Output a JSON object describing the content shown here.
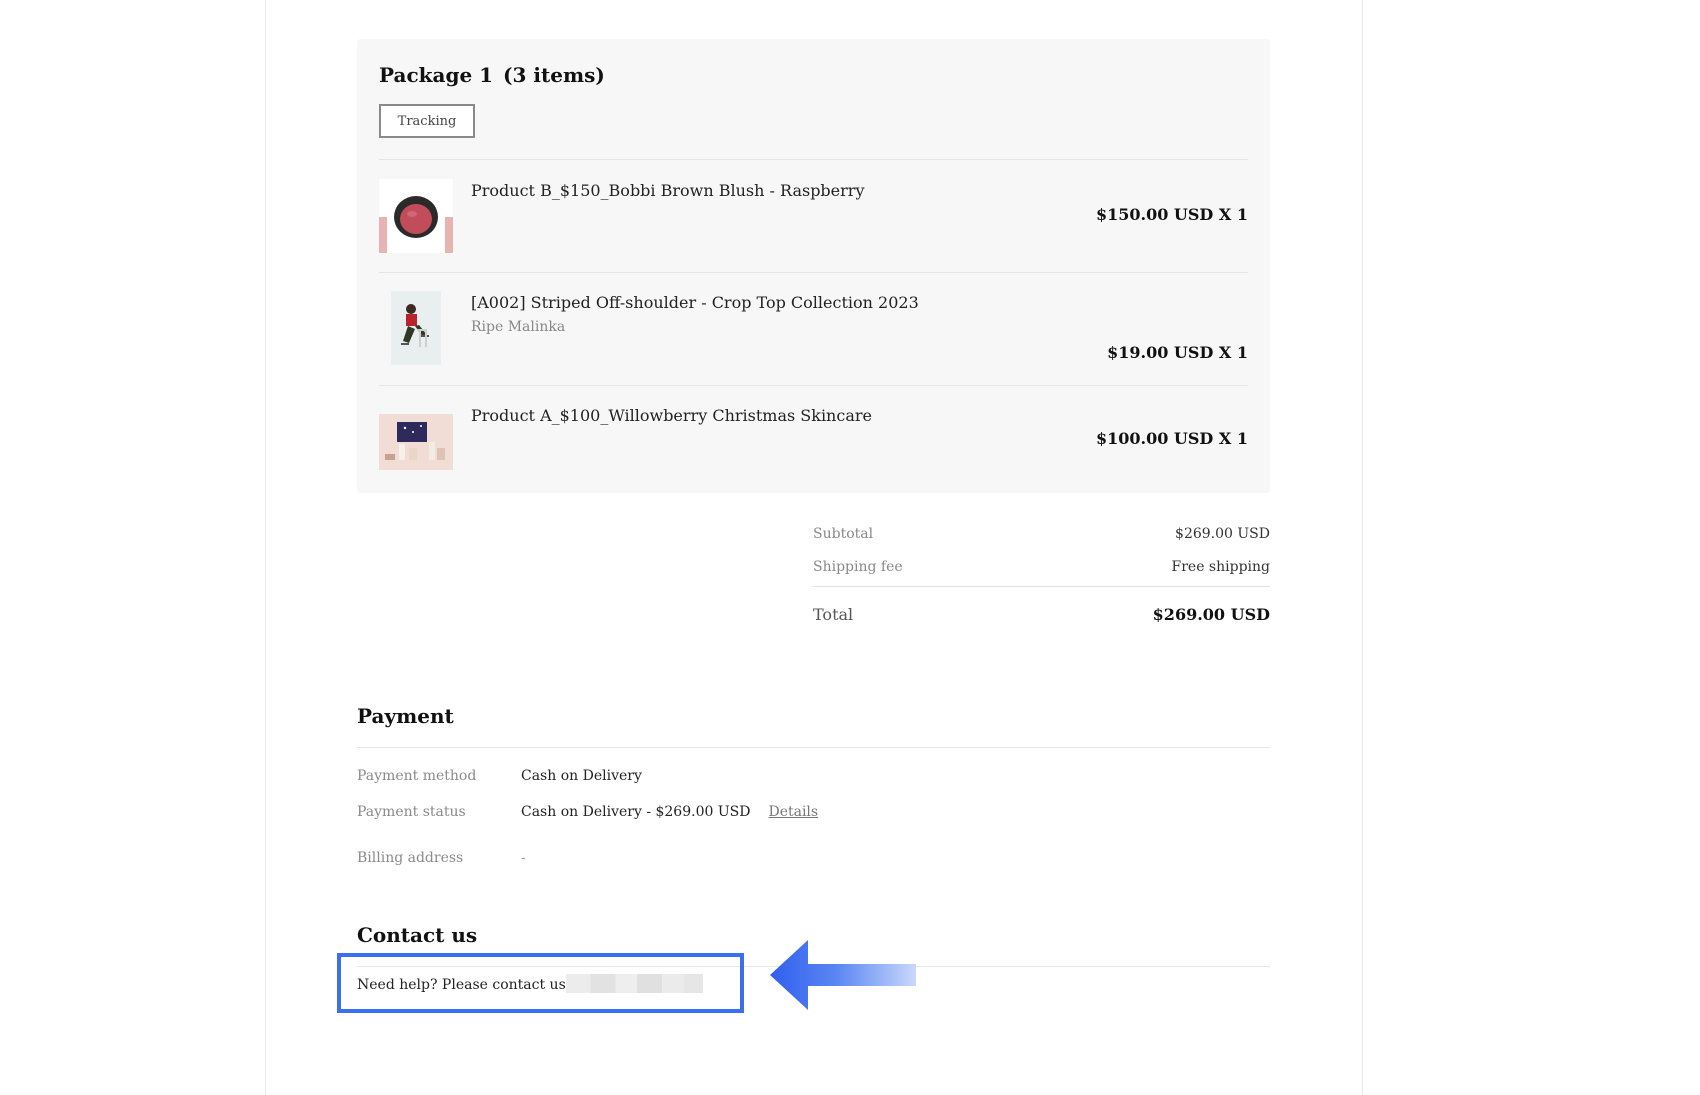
{
  "package": {
    "title": "Package 1",
    "count": "(3 items)",
    "tracking_label": "Tracking",
    "items": [
      {
        "name": "Product B_$150_Bobbi Brown Blush - Raspberry",
        "variant": "",
        "price": "$150.00 USD X 1",
        "thumb_icon": "blush-compact-image"
      },
      {
        "name": "[A002] Striped Off-shoulder - Crop Top Collection 2023",
        "variant": "Ripe Malinka",
        "price": "$19.00 USD X 1",
        "thumb_icon": "model-photo-image"
      },
      {
        "name": "Product A_$100_Willowberry Christmas Skincare",
        "variant": "",
        "price": "$100.00 USD X 1",
        "thumb_icon": "skincare-set-image"
      }
    ]
  },
  "summary": {
    "subtotal_label": "Subtotal",
    "subtotal_value": "$269.00 USD",
    "shipping_label": "Shipping fee",
    "shipping_value": "Free shipping",
    "total_label": "Total",
    "total_value": "$269.00 USD"
  },
  "payment": {
    "title": "Payment",
    "method_label": "Payment method",
    "method_value": "Cash on Delivery",
    "status_label": "Payment status",
    "status_value": "Cash on Delivery - $269.00 USD",
    "details_link": "Details",
    "billing_label": "Billing address",
    "billing_value": "-"
  },
  "contact": {
    "title": "Contact us",
    "text": "Need help? Please contact us"
  },
  "colors": {
    "highlight": "#3a6ff0",
    "card_bg": "#f7f7f7"
  }
}
